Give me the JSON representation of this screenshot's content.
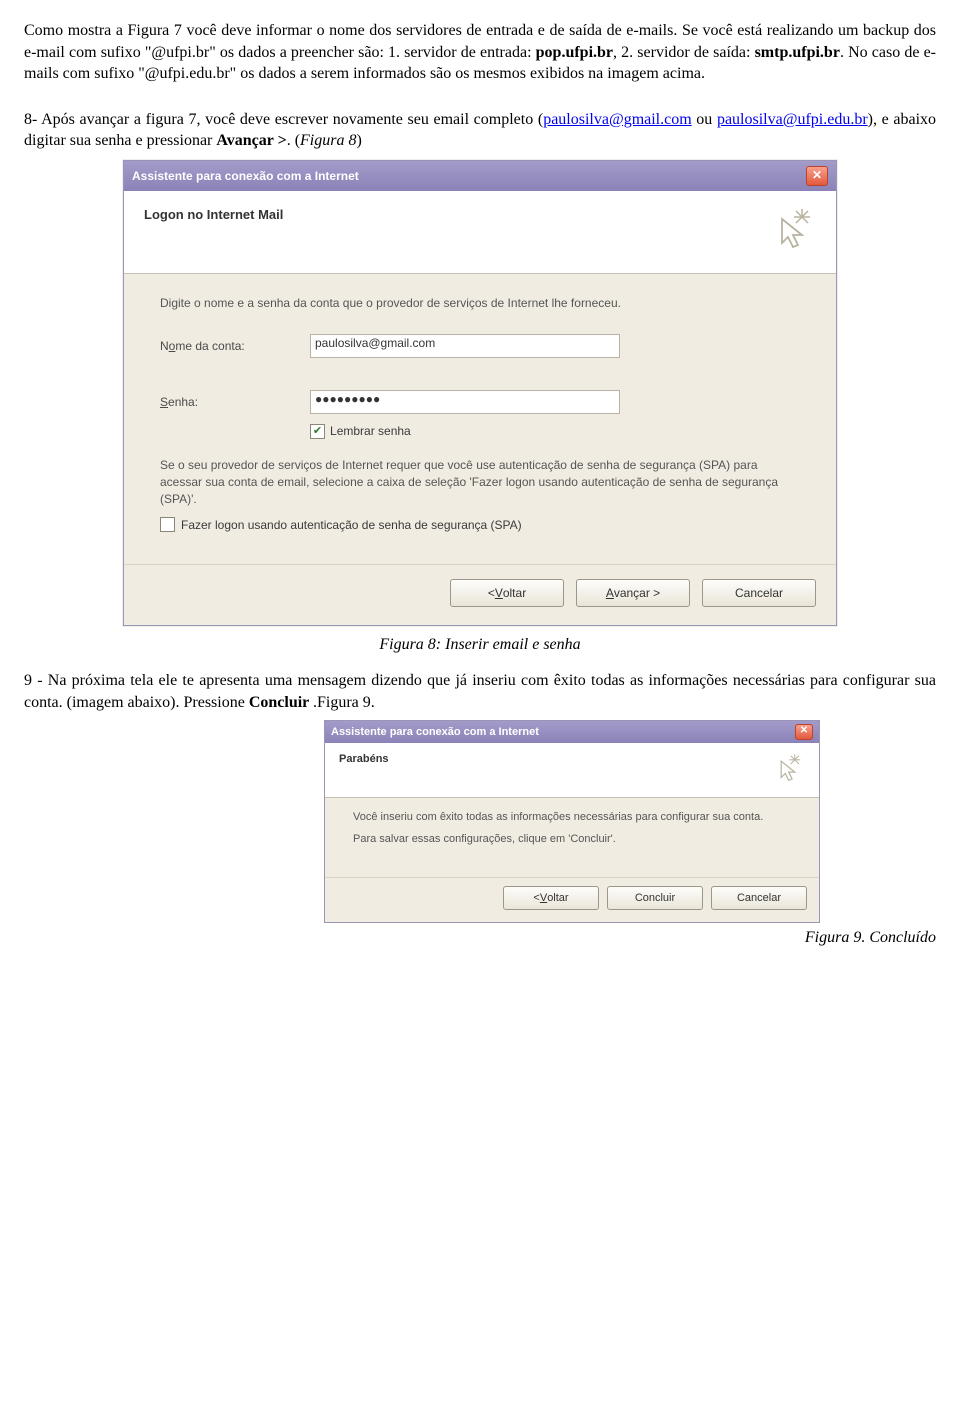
{
  "para1_a": "Como mostra a Figura 7 você deve informar o nome dos servidores de entrada e de saída de e-mails. Se você está realizando um backup dos e-mail com sufixo \"@ufpi.br\" os dados a preencher são: 1. servidor de entrada: ",
  "para1_pop": "pop.ufpi.br",
  "para1_b": ", 2. servidor de saída: ",
  "para1_smtp": "smtp.ufpi.br",
  "para1_c": ". No caso de e-mails com sufixo \"@ufpi.edu.br\" os dados a serem informados são os mesmos exibidos na imagem acima.",
  "para2_a": "8- Após avançar a figura 7, você deve escrever novamente seu email completo (",
  "para2_link1": "paulosilva@gmail.com",
  "para2_mid": " ou ",
  "para2_link2": "paulosilva@ufpi.edu.br",
  "para2_b": "), e abaixo digitar sua senha e pressionar ",
  "para2_av": "Avançar >",
  "para2_c": ". (",
  "para2_fig": "Figura 8",
  "para2_d": ")",
  "dlg1": {
    "title": "Assistente para conexão com a Internet",
    "heading": "Logon no Internet Mail",
    "desc": "Digite o nome e a senha da conta que o provedor de serviços de Internet lhe forneceu.",
    "account_label_pre": "N",
    "account_label_ul": "o",
    "account_label_post": "me da conta:",
    "account_value": "paulosilva@gmail.com",
    "password_label_ul": "S",
    "password_label_post": "enha:",
    "password_value": "●●●●●●●●●",
    "remember_ul": "L",
    "remember_post": "embrar senha",
    "spa_info": "Se o seu provedor de serviços de Internet requer que você use autenticação de senha de segurança (SPA) para acessar sua conta de email, selecione a caixa de seleção 'Fazer logon usando autenticação de senha de segurança (SPA)'.",
    "spa_check": "Fazer logon usando autenticação de senha de segurança (SPA)",
    "btn_back_pre": "< ",
    "btn_back_ul": "V",
    "btn_back_post": "oltar",
    "btn_next_ul": "A",
    "btn_next_post": "vançar >",
    "btn_cancel": "Cancelar"
  },
  "caption8": "Figura 8: Inserir email e senha",
  "para3_a": "9 - Na próxima tela ele te apresenta uma mensagem dizendo que já inseriu com êxito todas as informações necessárias para configurar sua conta. (imagem abaixo). Pressione ",
  "para3_b": "Concluir ",
  "para3_c": ".Figura 9.",
  "dlg2": {
    "title": "Assistente para conexão com a Internet",
    "heading": "Parabéns",
    "line1": "Você inseriu com êxito todas as informações necessárias para configurar sua conta.",
    "line2": "Para salvar essas configurações, clique em 'Concluir'.",
    "btn_back_pre": "< ",
    "btn_back_ul": "V",
    "btn_back_post": "oltar",
    "btn_finish": "Concluir",
    "btn_cancel": "Cancelar"
  },
  "caption9": "Figura 9. Concluído"
}
